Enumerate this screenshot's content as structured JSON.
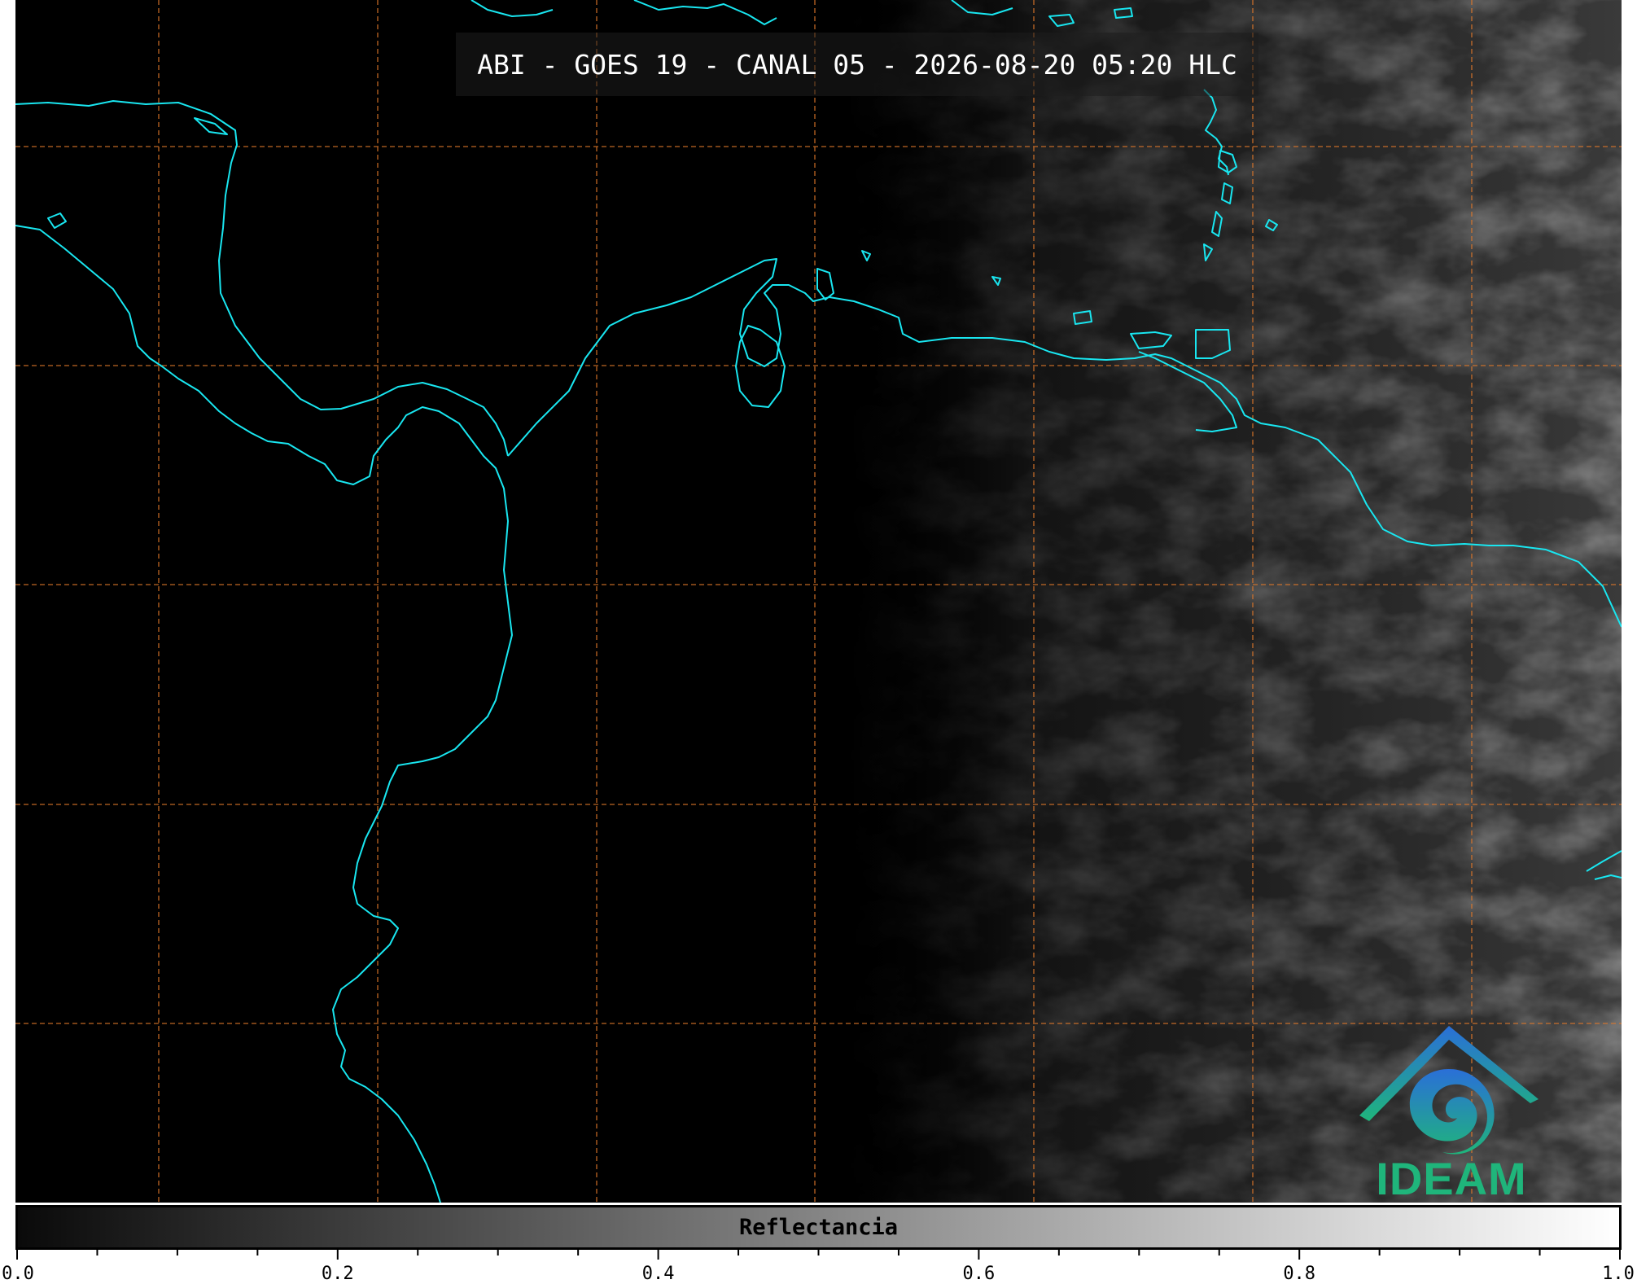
{
  "title": "ABI - GOES 19 - CANAL 05 - 2026-08-20 05:20 HLC",
  "logo": {
    "text": "IDEAM",
    "icon": "ideam-logo-icon"
  },
  "colorbar": {
    "label": "Reflectancia",
    "range": [
      0.0,
      1.0
    ],
    "tick_labels": [
      "0.0",
      "0.2",
      "0.4",
      "0.6",
      "0.8",
      "1.0"
    ],
    "colors": {
      "low": "#0a0a0a",
      "high": "#ffffff"
    }
  },
  "map": {
    "coastline_color": "#19e6f0",
    "gridline_color": "#e0782a",
    "background_color": "#000000"
  }
}
